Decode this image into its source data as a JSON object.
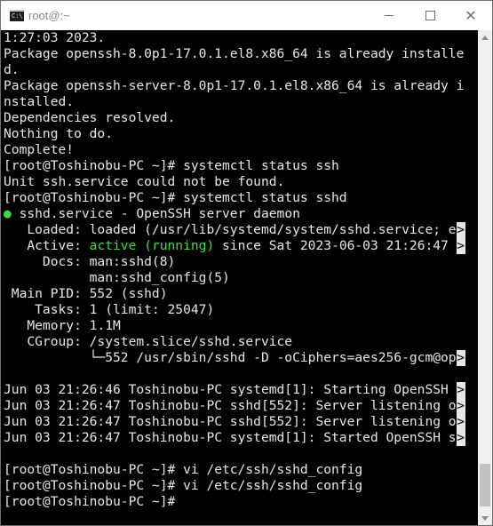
{
  "window": {
    "title": "root@:~",
    "icon_label": "C:\\",
    "icons": {
      "minimize": "minimize-icon",
      "maximize": "maximize-icon",
      "close": "close-icon"
    },
    "close_glyph": "✕"
  },
  "colors": {
    "background": "#000000",
    "text": "#e6e6e6",
    "accent_green": "#3bdc3b"
  },
  "terminal": {
    "lines": [
      "1:27:03 2023.",
      "Package openssh-8.0p1-17.0.1.el8.x86_64 is already installe",
      "d.",
      "Package openssh-server-8.0p1-17.0.1.el8.x86_64 is already i",
      "nstalled.",
      "Dependencies resolved.",
      "Nothing to do.",
      "Complete!",
      "[root@Toshinobu-PC ~]# systemctl status ssh",
      "Unit ssh.service could not be found.",
      "[root@Toshinobu-PC ~]# systemctl status sshd",
      " sshd.service - OpenSSH server daemon",
      "   Loaded: loaded (/usr/lib/systemd/system/sshd.service; e",
      "   Active: ",
      "active (running)",
      " since Sat 2023-06-03 21:26:47 ",
      "     Docs: man:sshd(8)",
      "           man:sshd_config(5)",
      " Main PID: 552 (sshd)",
      "    Tasks: 1 (limit: 25047)",
      "   Memory: 1.1M",
      "   CGroup: /system.slice/sshd.service",
      "           └─552 /usr/sbin/sshd -D -oCiphers=aes256-gcm@op",
      "Jun 03 21:26:46 Toshinobu-PC systemd[1]: Starting OpenSSH ",
      "Jun 03 21:26:47 Toshinobu-PC sshd[552]: Server listening o",
      "Jun 03 21:26:47 Toshinobu-PC sshd[552]: Server listening o",
      "Jun 03 21:26:47 Toshinobu-PC systemd[1]: Started OpenSSH s",
      "[root@Toshinobu-PC ~]# vi /etc/ssh/sshd_config",
      "[root@Toshinobu-PC ~]# vi /etc/ssh/sshd_config",
      "[root@Toshinobu-PC ~]#"
    ],
    "bullet": "●",
    "trunc_marker": ">"
  }
}
